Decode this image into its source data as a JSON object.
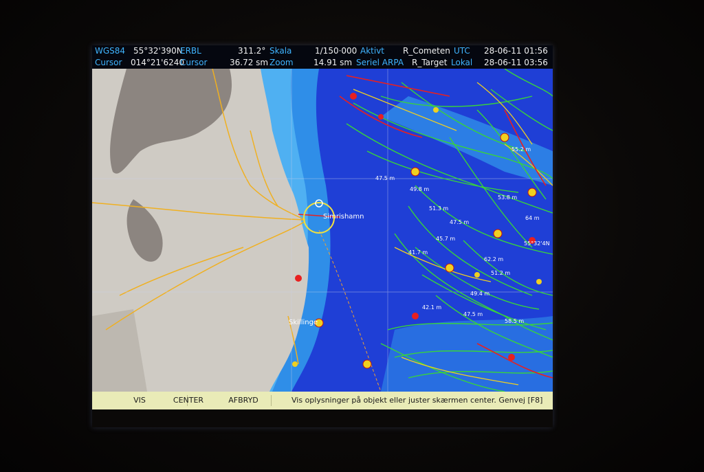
{
  "status_bar": {
    "datum_label": "WGS84",
    "latitude": "55°32'390N",
    "cursor_label": "Cursor",
    "longitude": "014°21'6240",
    "erbl_label": "ERBL",
    "erbl_bearing": "311.2°",
    "erbl_cursor_label": "Cursor",
    "erbl_distance": "36.72 sm",
    "scale_label": "Skala",
    "scale_value": "1/150·000",
    "zoom_label": "Zoom",
    "zoom_value": "14.91 sm",
    "active_label": "Aktivt",
    "active_value": "R_Cometen",
    "serial_label": "Seriel ARPA",
    "serial_value": "R_Target",
    "utc_label": "UTC",
    "utc_value": "28-06-11 01:56",
    "local_label": "Lokal",
    "local_value": "28-06-11 03:56"
  },
  "chart": {
    "place_1": "Simrishamn",
    "place_2": "Skillinge",
    "lat_label": "55°32'4N",
    "depths": [
      "47.5 m",
      "49.8 m",
      "51.3 m",
      "47.5 m",
      "45.7 m",
      "41.7 m",
      "62.2 m",
      "51.2 m",
      "49.4 m",
      "42.1 m",
      "47.5 m",
      "58.5 m",
      "64 m",
      "55.2 m",
      "53.8 m"
    ],
    "colors": {
      "land": "#cfcbc4",
      "land_dark": "#8c8580",
      "deep_sea": "#1f3fd6",
      "shallow_sea": "#2f8ee8",
      "tracks": "#38d43a",
      "routes": "#e82020",
      "roads": "#f0b020"
    }
  },
  "bottom_bar": {
    "vis_label": "VIS",
    "center_label": "CENTER",
    "afbryd_label": "AFBRYD",
    "hint_text": "Vis oplysninger på objekt eller juster skærmen center. Genvej [F8]"
  }
}
